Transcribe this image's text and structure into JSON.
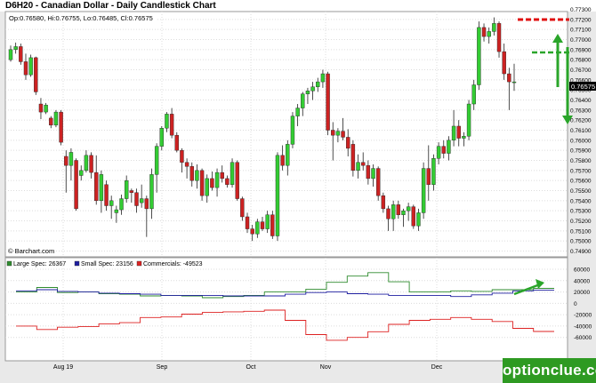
{
  "header": {
    "title": "D6H20 - Canadian Dollar - Daily Candlestick Chart"
  },
  "price_panel": {
    "ohlc_label": "Op:0.76580, Hi:0.76755, Lo:0.76485, Cl:0.76575",
    "source_label": "© Barchart.com",
    "last_price": "0.76575"
  },
  "cot_panel": {
    "legend": [
      {
        "label": "Large Spec: 26367",
        "color": "#2e8b2e"
      },
      {
        "label": "Small Spec: 23156",
        "color": "#1f1fa0"
      },
      {
        "label": "Commercials: -49523",
        "color": "#dd2222"
      }
    ]
  },
  "brand": {
    "text": "optionclue.com"
  },
  "colors": {
    "up": "#33cc33",
    "down": "#cc2222",
    "annotation_red": "#e01010",
    "annotation_green": "#2aa52a"
  },
  "chart_data": [
    {
      "type": "candlestick",
      "title": "D6H20 - Canadian Dollar - Daily Candlestick Chart",
      "ylim": [
        0.749,
        0.773
      ],
      "y_ticks": [
        "0.77300",
        "0.77200",
        "0.77100",
        "0.77000",
        "0.76900",
        "0.76800",
        "0.76700",
        "0.76600",
        "0.76500",
        "0.76400",
        "0.76300",
        "0.76200",
        "0.76100",
        "0.76000",
        "0.75900",
        "0.75800",
        "0.75700",
        "0.75600",
        "0.75500",
        "0.75400",
        "0.75300",
        "0.75200",
        "0.75100",
        "0.75000",
        "0.74900"
      ],
      "x_labels": [
        "Aug 19",
        "Sep",
        "Oct",
        "Nov",
        "Dec"
      ],
      "candles": [
        [
          0.768,
          0.7694,
          0.7678,
          0.769
        ],
        [
          0.769,
          0.7697,
          0.7686,
          0.7693
        ],
        [
          0.7693,
          0.7696,
          0.7675,
          0.7678
        ],
        [
          0.7678,
          0.7686,
          0.766,
          0.7665
        ],
        [
          0.7665,
          0.7685,
          0.7663,
          0.7682
        ],
        [
          0.7682,
          0.7683,
          0.7645,
          0.7648
        ],
        [
          0.7636,
          0.7642,
          0.7621,
          0.7628
        ],
        [
          0.7628,
          0.7637,
          0.7626,
          0.7635
        ],
        [
          0.7622,
          0.7624,
          0.7612,
          0.7615
        ],
        [
          0.7615,
          0.763,
          0.7613,
          0.7628
        ],
        [
          0.7628,
          0.763,
          0.7595,
          0.7598
        ],
        [
          0.7584,
          0.759,
          0.7548,
          0.7575
        ],
        [
          0.7575,
          0.7592,
          0.756,
          0.7588
        ],
        [
          0.758,
          0.7582,
          0.753,
          0.7532
        ],
        [
          0.7565,
          0.7575,
          0.756,
          0.757
        ],
        [
          0.757,
          0.759,
          0.7568,
          0.7585
        ],
        [
          0.7585,
          0.7588,
          0.7562,
          0.7568
        ],
        [
          0.7568,
          0.7585,
          0.7536,
          0.754
        ],
        [
          0.754,
          0.757,
          0.7528,
          0.7566
        ],
        [
          0.7556,
          0.756,
          0.753,
          0.7535
        ],
        [
          0.7535,
          0.7545,
          0.7522,
          0.754
        ],
        [
          0.7528,
          0.7535,
          0.7518,
          0.7531
        ],
        [
          0.7531,
          0.7546,
          0.7526,
          0.7542
        ],
        [
          0.7542,
          0.7565,
          0.7538,
          0.756
        ],
        [
          0.755,
          0.7552,
          0.7538,
          0.7548
        ],
        [
          0.7548,
          0.7552,
          0.7528,
          0.7535
        ],
        [
          0.7538,
          0.7556,
          0.7533,
          0.7542
        ],
        [
          0.7542,
          0.7545,
          0.7504,
          0.7532
        ],
        [
          0.7532,
          0.7572,
          0.7522,
          0.7566
        ],
        [
          0.7566,
          0.7597,
          0.7548,
          0.7594
        ],
        [
          0.7594,
          0.7614,
          0.759,
          0.7612
        ],
        [
          0.7612,
          0.7628,
          0.7608,
          0.7626
        ],
        [
          0.7626,
          0.7632,
          0.7602,
          0.7605
        ],
        [
          0.7605,
          0.7608,
          0.7588,
          0.759
        ],
        [
          0.759,
          0.7592,
          0.7568,
          0.7578
        ],
        [
          0.7578,
          0.7582,
          0.7562,
          0.7574
        ],
        [
          0.7574,
          0.7578,
          0.7554,
          0.756
        ],
        [
          0.756,
          0.7576,
          0.7552,
          0.757
        ],
        [
          0.757,
          0.7572,
          0.754,
          0.7545
        ],
        [
          0.7545,
          0.7566,
          0.7538,
          0.7562
        ],
        [
          0.7562,
          0.7569,
          0.755,
          0.7553
        ],
        [
          0.7553,
          0.7572,
          0.7544,
          0.7568
        ],
        [
          0.7568,
          0.7575,
          0.7558,
          0.7562
        ],
        [
          0.7562,
          0.7565,
          0.7553,
          0.7556
        ],
        [
          0.7556,
          0.7582,
          0.7553,
          0.7578
        ],
        [
          0.7578,
          0.758,
          0.754,
          0.7542
        ],
        [
          0.7542,
          0.7544,
          0.752,
          0.7524
        ],
        [
          0.7524,
          0.7528,
          0.7508,
          0.7512
        ],
        [
          0.7512,
          0.7516,
          0.75,
          0.7507
        ],
        [
          0.7507,
          0.7522,
          0.7503,
          0.7519
        ],
        [
          0.7519,
          0.7524,
          0.751,
          0.7512
        ],
        [
          0.7512,
          0.753,
          0.7508,
          0.7526
        ],
        [
          0.7526,
          0.753,
          0.7502,
          0.7505
        ],
        [
          0.7505,
          0.7588,
          0.75,
          0.7585
        ],
        [
          0.7585,
          0.7595,
          0.757,
          0.7575
        ],
        [
          0.7575,
          0.76,
          0.7565,
          0.7596
        ],
        [
          0.7596,
          0.7628,
          0.7592,
          0.7624
        ],
        [
          0.7624,
          0.7636,
          0.7614,
          0.7632
        ],
        [
          0.7632,
          0.7648,
          0.7624,
          0.7646
        ],
        [
          0.7646,
          0.7652,
          0.7636,
          0.7649
        ],
        [
          0.7649,
          0.7658,
          0.764,
          0.7653
        ],
        [
          0.7653,
          0.7662,
          0.7648,
          0.7658
        ],
        [
          0.7658,
          0.767,
          0.7652,
          0.7666
        ],
        [
          0.7666,
          0.7668,
          0.7605,
          0.761
        ],
        [
          0.761,
          0.7618,
          0.758,
          0.7605
        ],
        [
          0.7605,
          0.7612,
          0.7598,
          0.7609
        ],
        [
          0.7609,
          0.7622,
          0.76,
          0.7603
        ],
        [
          0.7603,
          0.7611,
          0.7584,
          0.7592
        ],
        [
          0.7596,
          0.76,
          0.7564,
          0.757
        ],
        [
          0.757,
          0.7586,
          0.7562,
          0.7578
        ],
        [
          0.7578,
          0.7588,
          0.757,
          0.7575
        ],
        [
          0.7575,
          0.758,
          0.7556,
          0.7562
        ],
        [
          0.7562,
          0.7576,
          0.7554,
          0.7572
        ],
        [
          0.7572,
          0.7574,
          0.754,
          0.7545
        ],
        [
          0.7545,
          0.7548,
          0.7528,
          0.7532
        ],
        [
          0.7532,
          0.7535,
          0.751,
          0.7522
        ],
        [
          0.7522,
          0.754,
          0.751,
          0.7536
        ],
        [
          0.7536,
          0.754,
          0.7522,
          0.7526
        ],
        [
          0.7526,
          0.7532,
          0.7514,
          0.753
        ],
        [
          0.753,
          0.7538,
          0.752,
          0.7534
        ],
        [
          0.7534,
          0.7536,
          0.7512,
          0.7515
        ],
        [
          0.7515,
          0.7532,
          0.751,
          0.7528
        ],
        [
          0.7528,
          0.7578,
          0.7522,
          0.7572
        ],
        [
          0.7572,
          0.7595,
          0.754,
          0.7556
        ],
        [
          0.7556,
          0.7586,
          0.755,
          0.7582
        ],
        [
          0.7582,
          0.7598,
          0.7576,
          0.7594
        ],
        [
          0.7594,
          0.76,
          0.7582,
          0.7587
        ],
        [
          0.7587,
          0.7604,
          0.758,
          0.76
        ],
        [
          0.76,
          0.763,
          0.7594,
          0.7614
        ],
        [
          0.7614,
          0.762,
          0.7594,
          0.7602
        ],
        [
          0.7602,
          0.7608,
          0.7594,
          0.7604
        ],
        [
          0.7604,
          0.764,
          0.76,
          0.7636
        ],
        [
          0.7636,
          0.766,
          0.763,
          0.7655
        ],
        [
          0.7655,
          0.7718,
          0.765,
          0.7712
        ],
        [
          0.7712,
          0.7716,
          0.7698,
          0.7703
        ],
        [
          0.7703,
          0.7712,
          0.7696,
          0.7708
        ],
        [
          0.7708,
          0.7722,
          0.7704,
          0.7716
        ],
        [
          0.7716,
          0.7718,
          0.7682,
          0.7688
        ],
        [
          0.7688,
          0.7696,
          0.766,
          0.7666
        ],
        [
          0.7666,
          0.7672,
          0.763,
          0.7658
        ],
        [
          0.7658,
          0.7676,
          0.7649,
          0.7658
        ]
      ]
    },
    {
      "type": "line",
      "ylim": [
        -80000,
        60000
      ],
      "y_ticks": [
        "60000",
        "40000",
        "20000",
        "0",
        "-20000",
        "-40000",
        "-60000"
      ],
      "series": [
        {
          "name": "Large Spec",
          "values": [
            20000,
            28000,
            19000,
            20000,
            17000,
            16000,
            13000,
            14000,
            13000,
            10000,
            12000,
            14000,
            20000,
            20000,
            25000,
            37000,
            48000,
            54000,
            38000,
            20000,
            20000,
            22000,
            21000,
            24000,
            24000,
            26367
          ]
        },
        {
          "name": "Small Spec",
          "values": [
            22000,
            24000,
            21000,
            20000,
            18000,
            17000,
            16000,
            14000,
            14000,
            14000,
            13000,
            13000,
            13000,
            16000,
            19000,
            20000,
            17000,
            16000,
            14000,
            14000,
            14000,
            12000,
            15000,
            18000,
            22000,
            23156
          ]
        },
        {
          "name": "Commercials",
          "values": [
            -40000,
            -46000,
            -42000,
            -41000,
            -36000,
            -34000,
            -25000,
            -24000,
            -19000,
            -16000,
            -15000,
            -14000,
            -12000,
            -30000,
            -55000,
            -65000,
            -60000,
            -50000,
            -37000,
            -30000,
            -28000,
            -25000,
            -28000,
            -32000,
            -44000,
            -49523
          ]
        }
      ]
    }
  ]
}
